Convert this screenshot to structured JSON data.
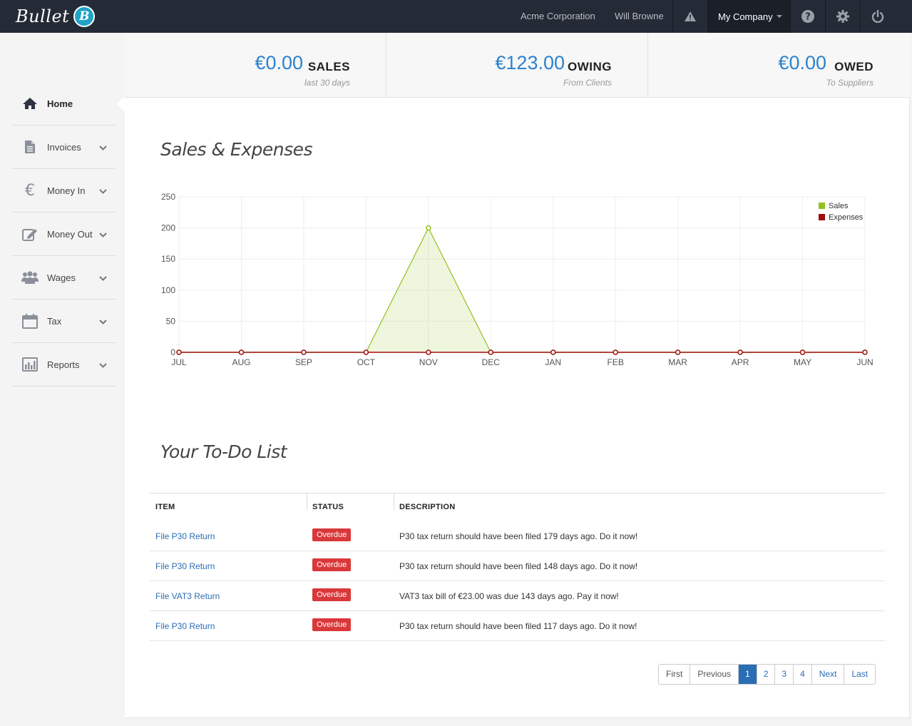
{
  "header": {
    "logo_text": "Bullet",
    "logo_badge": "B",
    "org_name": "Acme Corporation",
    "user_name": "Will Browne",
    "company_menu": "My Company",
    "icons": [
      "warning-icon",
      "help-icon",
      "gear-icon",
      "power-icon"
    ]
  },
  "sidebar": {
    "items": [
      {
        "label": "Home",
        "icon": "home-icon",
        "active": true
      },
      {
        "label": "Invoices",
        "icon": "document-icon"
      },
      {
        "label": "Money In",
        "icon": "euro-icon"
      },
      {
        "label": "Money Out",
        "icon": "edit-icon"
      },
      {
        "label": "Wages",
        "icon": "users-icon"
      },
      {
        "label": "Tax",
        "icon": "calendar-icon"
      },
      {
        "label": "Reports",
        "icon": "bar-chart-icon"
      }
    ]
  },
  "stats": [
    {
      "amount": "€0.00",
      "word": "SALES",
      "sub": "last 30 days"
    },
    {
      "amount": "€123.00",
      "word": "OWING",
      "sub": "From Clients"
    },
    {
      "amount": "€0.00",
      "word": "OWED",
      "sub": "To Suppliers"
    }
  ],
  "chart_section": {
    "title": "Sales & Expenses"
  },
  "chart_data": {
    "type": "area",
    "categories": [
      "JUL",
      "AUG",
      "SEP",
      "OCT",
      "NOV",
      "DEC",
      "JAN",
      "FEB",
      "MAR",
      "APR",
      "MAY",
      "JUN"
    ],
    "series": [
      {
        "name": "Sales",
        "color": "#94c11f",
        "values": [
          0,
          0,
          0,
          0,
          200,
          0,
          0,
          0,
          0,
          0,
          0,
          0
        ]
      },
      {
        "name": "Expenses",
        "color": "#a00d0d",
        "values": [
          0,
          0,
          0,
          0,
          0,
          0,
          0,
          0,
          0,
          0,
          0,
          0
        ]
      }
    ],
    "yticks": [
      0,
      50,
      100,
      150,
      200,
      250
    ],
    "ylim": [
      0,
      250
    ],
    "grid": true,
    "legend": "top-right"
  },
  "todo": {
    "title": "Your To-Do List",
    "columns": [
      "ITEM",
      "STATUS",
      "DESCRIPTION"
    ],
    "rows": [
      {
        "item": "File P30 Return",
        "status": "Overdue",
        "description": "P30 tax return should have been filed 179 days ago. Do it now!"
      },
      {
        "item": "File P30 Return",
        "status": "Overdue",
        "description": "P30 tax return should have been filed 148 days ago. Do it now!"
      },
      {
        "item": "File VAT3 Return",
        "status": "Overdue",
        "description": "VAT3 tax bill of €23.00 was due 143 days ago. Pay it now!"
      },
      {
        "item": "File P30 Return",
        "status": "Overdue",
        "description": "P30 tax return should have been filed 117 days ago. Do it now!"
      }
    ]
  },
  "pagination": {
    "first": "First",
    "previous": "Previous",
    "pages": [
      "1",
      "2",
      "3",
      "4"
    ],
    "current": "1",
    "next": "Next",
    "last": "Last"
  }
}
